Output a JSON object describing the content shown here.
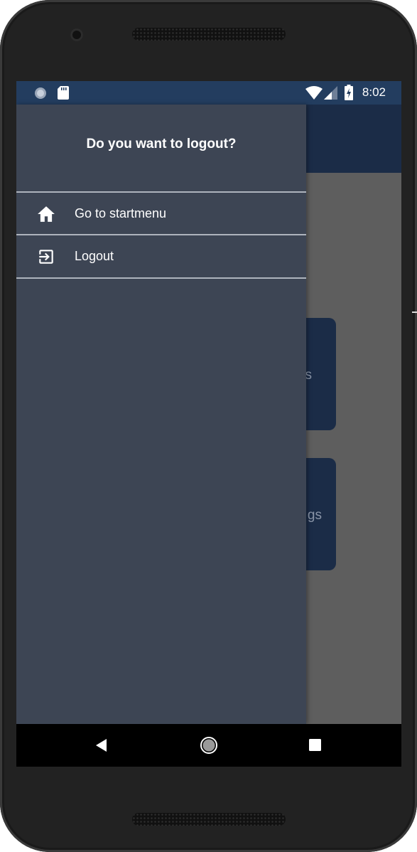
{
  "status_bar": {
    "time": "8:02"
  },
  "drawer": {
    "title": "Do you want to logout?",
    "items": [
      {
        "label": "Go to startmenu",
        "icon": "home-icon"
      },
      {
        "label": "Logout",
        "icon": "exit-to-app-icon"
      }
    ]
  },
  "background": {
    "cards": [
      {
        "label_fragment": "s"
      },
      {
        "label_fragment": "gs"
      }
    ]
  },
  "colors": {
    "status_bar": "#233d5f",
    "app_bar": "#1b2c47",
    "drawer": "#3d4554",
    "scrim": "#5e5e5e"
  }
}
